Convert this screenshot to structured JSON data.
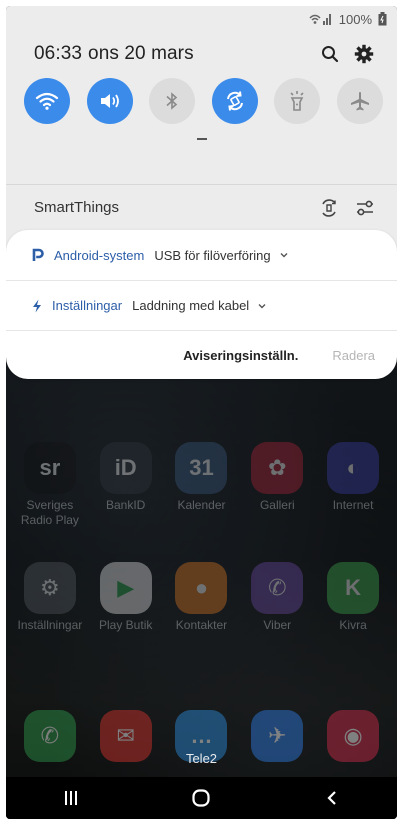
{
  "status_bar": {
    "battery": "100%"
  },
  "header": {
    "time": "06:33",
    "date": "ons 20 mars"
  },
  "quick_settings": [
    {
      "name": "wifi",
      "active": true
    },
    {
      "name": "sound",
      "active": true
    },
    {
      "name": "bluetooth",
      "active": false
    },
    {
      "name": "auto-rotate",
      "active": true
    },
    {
      "name": "flashlight",
      "active": false
    },
    {
      "name": "airplane-mode",
      "active": false
    }
  ],
  "smartthings": {
    "label": "SmartThings"
  },
  "notifications": [
    {
      "app": "Android-system",
      "text": "USB för filöverföring"
    },
    {
      "app": "Inställningar",
      "text": "Laddning med kabel"
    }
  ],
  "notification_actions": {
    "settings": "Aviseringsinställn.",
    "clear": "Radera"
  },
  "home_apps_row1": [
    {
      "label": "Sveriges Radio Play",
      "color": "#111111",
      "glyph": "sr"
    },
    {
      "label": "BankID",
      "color": "#2f3640",
      "glyph": "iD"
    },
    {
      "label": "Kalender",
      "color": "#3a5a80",
      "glyph": "31"
    },
    {
      "label": "Galleri",
      "color": "#b0243a",
      "glyph": "✿"
    },
    {
      "label": "Internet",
      "color": "#3b3fa8",
      "glyph": "◐"
    }
  ],
  "home_apps_row2": [
    {
      "label": "Inställningar",
      "color": "#555c63",
      "glyph": "⚙"
    },
    {
      "label": "Play Butik",
      "color": "#e9e9e9",
      "glyph": "▶"
    },
    {
      "label": "Kontakter",
      "color": "#e07a22",
      "glyph": "●"
    },
    {
      "label": "Viber",
      "color": "#6e4aa8",
      "glyph": "✆"
    },
    {
      "label": "Kivra",
      "color": "#3fae4f",
      "glyph": "K"
    }
  ],
  "dock_apps": [
    {
      "label": "",
      "color": "#2e9b4c",
      "glyph": "✆"
    },
    {
      "label": "",
      "color": "#d9342e",
      "glyph": "✉"
    },
    {
      "label": "",
      "color": "#2d8fe0",
      "glyph": "…"
    },
    {
      "label": "",
      "color": "#2f7fe8",
      "glyph": "✈"
    },
    {
      "label": "",
      "color": "#d32b4a",
      "glyph": "◉"
    }
  ],
  "carrier": "Tele2"
}
